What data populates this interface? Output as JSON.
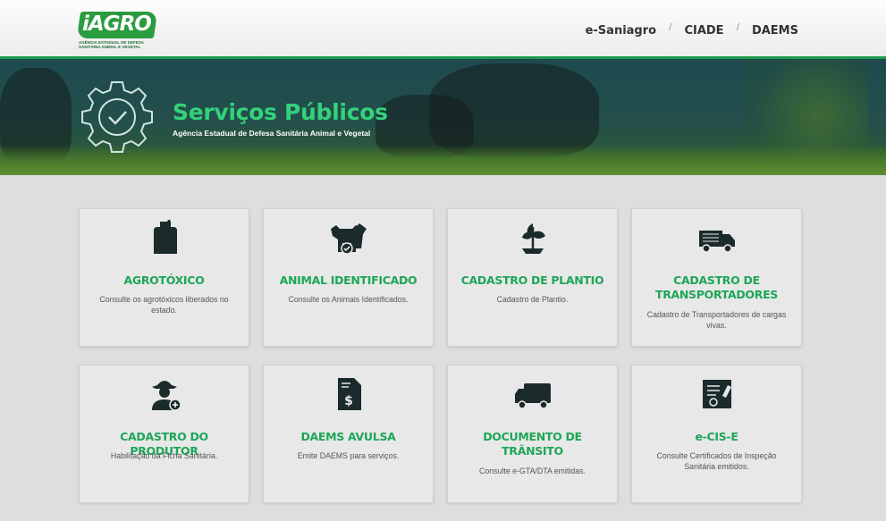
{
  "header": {
    "logo_text": "iAGRO",
    "logo_subtitle": "AGÊNCIA ESTADUAL DE DEFESA SANITÁRIA ANIMAL E VEGETAL",
    "nav": [
      {
        "label": "e-Saniagro"
      },
      {
        "label": "CIADE"
      },
      {
        "label": "DAEMS"
      }
    ],
    "separator": "/"
  },
  "banner": {
    "title": "Serviços Públicos",
    "subtitle": "Agência Estadual de Defesa Sanitária Animal e Vegetal"
  },
  "cards": [
    {
      "title": "AGROTÓXICO",
      "desc": "Consulte os agrotóxicos liberados no estado.",
      "icon": "canister-icon"
    },
    {
      "title": "ANIMAL IDENTIFICADO",
      "desc": "Consulte os Animais Identificados.",
      "icon": "animals-icon"
    },
    {
      "title": "CADASTRO DE PLANTIO",
      "desc": "Cadastro de Plantio.",
      "icon": "seedling-icon"
    },
    {
      "title": "CADASTRO DE TRANSPORTADORES",
      "desc": "Cadastro de Transportadores de cargas vivas.",
      "icon": "livestock-truck-icon"
    },
    {
      "title": "CADASTRO DO PRODUTOR",
      "desc": "Habilitação da Ficha Sanitária.",
      "icon": "farmer-icon"
    },
    {
      "title": "DAEMS AVULSA",
      "desc": "Emite DAEMS para serviços.",
      "icon": "invoice-icon"
    },
    {
      "title": "DOCUMENTO DE TRÂNSITO",
      "desc": "Consulte e-GTA/DTA emitidas.",
      "icon": "truck-icon"
    },
    {
      "title": "e-CIS-E",
      "desc": "Consulte Certificados de Inspeção Sanitária emitidos.",
      "icon": "certificate-icon"
    }
  ],
  "colors": {
    "accent_green": "#1da657",
    "banner_title": "#33d27a",
    "icon_dark": "#1b2b2b"
  }
}
